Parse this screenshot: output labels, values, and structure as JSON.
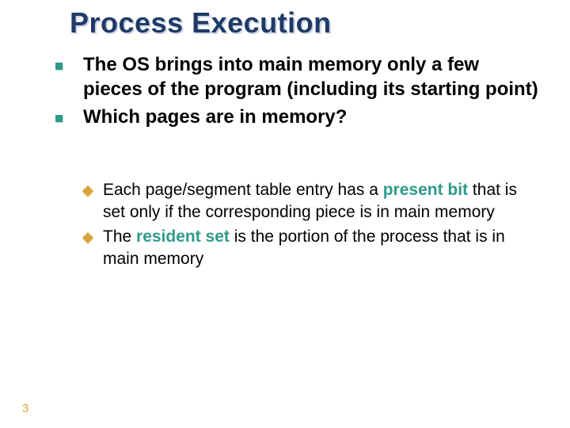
{
  "title": "Process Execution",
  "bullets": [
    "The OS brings into main memory only a few pieces of the program (including its starting point)",
    "Which pages are in memory?"
  ],
  "sub": [
    {
      "pre": "Each page/segment table entry has a ",
      "em": "present bit",
      "post": " that is set only if the corresponding piece is in main memory"
    },
    {
      "pre": "The ",
      "em": "resident set",
      "post": "  is the portion of the process that is in main memory"
    }
  ],
  "page": "3"
}
